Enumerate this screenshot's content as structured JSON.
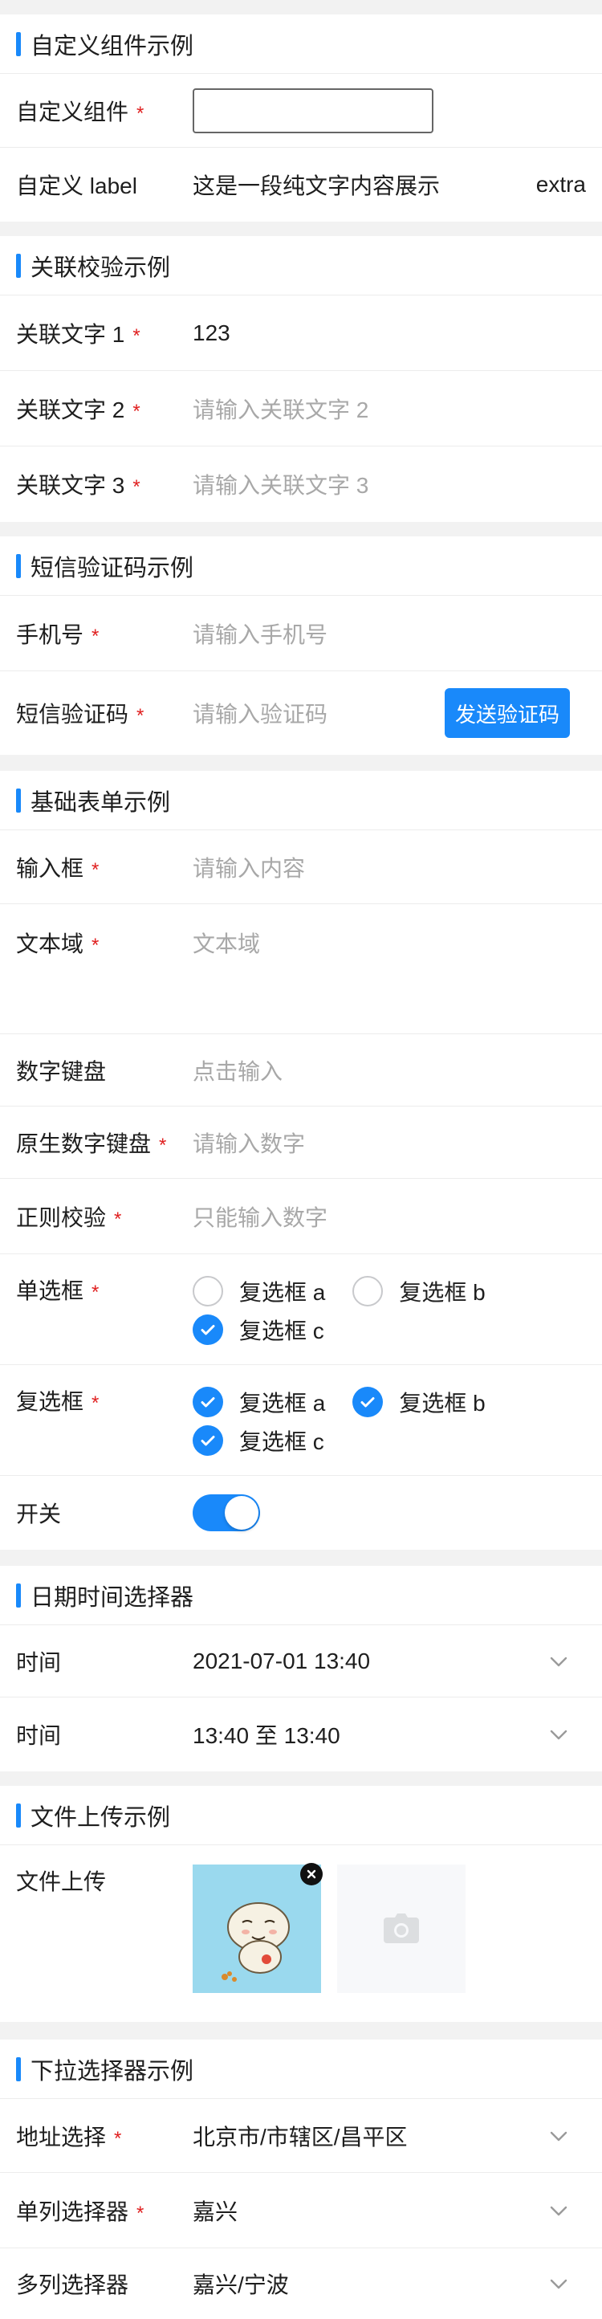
{
  "custom": {
    "title": "自定义组件示例",
    "field1_label": "自定义组件",
    "field2_label": "自定义 label",
    "field2_value": "这是一段纯文字内容展示",
    "field2_extra": "extra"
  },
  "linked": {
    "title": "关联校验示例",
    "text1_label": "关联文字 1",
    "text1_value": "123",
    "text2_label": "关联文字 2",
    "text2_placeholder": "请输入关联文字 2",
    "text3_label": "关联文字 3",
    "text3_placeholder": "请输入关联文字 3"
  },
  "sms": {
    "title": "短信验证码示例",
    "phone_label": "手机号",
    "phone_placeholder": "请输入手机号",
    "code_label": "短信验证码",
    "code_placeholder": "请输入验证码",
    "send_button": "发送验证码"
  },
  "basic": {
    "title": "基础表单示例",
    "input_label": "输入框",
    "input_placeholder": "请输入内容",
    "textarea_label": "文本域",
    "textarea_placeholder": "文本域",
    "numkey_label": "数字键盘",
    "numkey_placeholder": "点击输入",
    "native_label": "原生数字键盘",
    "native_placeholder": "请输入数字",
    "regex_label": "正则校验",
    "regex_placeholder": "只能输入数字",
    "radio_label": "单选框",
    "radio_options": [
      {
        "label": "复选框 a",
        "checked": false
      },
      {
        "label": "复选框 b",
        "checked": false
      },
      {
        "label": "复选框 c",
        "checked": true
      }
    ],
    "checkbox_label": "复选框",
    "checkbox_options": [
      {
        "label": "复选框 a",
        "checked": true
      },
      {
        "label": "复选框 b",
        "checked": true
      },
      {
        "label": "复选框 c",
        "checked": true
      }
    ],
    "switch_label": "开关",
    "switch_on": true
  },
  "datetime": {
    "title": "日期时间选择器",
    "time1_label": "时间",
    "time1_value": "2021-07-01 13:40",
    "time2_label": "时间",
    "time2_value": "13:40 至 13:40"
  },
  "upload": {
    "title": "文件上传示例",
    "label": "文件上传"
  },
  "picker": {
    "title": "下拉选择器示例",
    "address_label": "地址选择",
    "address_value": "北京市/市辖区/昌平区",
    "single_label": "单列选择器",
    "single_value": "嘉兴",
    "multi_label": "多列选择器",
    "multi_value": "嘉兴/宁波"
  },
  "colors": {
    "accent": "#1989fa",
    "required": "#e02020",
    "placeholder": "#a8a8a8"
  },
  "icons": [
    "chevron-down-icon",
    "check-icon",
    "close-icon",
    "camera-icon"
  ]
}
